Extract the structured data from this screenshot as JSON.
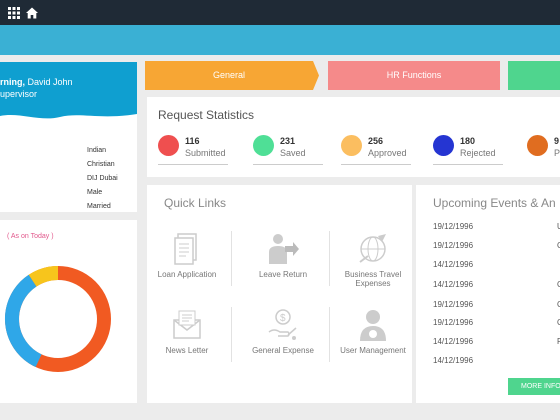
{
  "profile": {
    "greeting_bold": "rning,",
    "greeting_name": " David John",
    "role": "upervisor",
    "details": [
      "Indian",
      "Christian",
      "DIJ Dubai",
      "Male",
      "Married"
    ]
  },
  "chart": {
    "as_of": "( As on Today )"
  },
  "tabs": [
    {
      "label": "General",
      "color": "#f7a634"
    },
    {
      "label": "HR Functions",
      "color": "#f58a8a"
    },
    {
      "label": "",
      "color": "#4fd58e"
    }
  ],
  "stats": {
    "title": "Request Statistics",
    "items": [
      {
        "count": "116",
        "label": "Submitted",
        "color": "#ef4f4f"
      },
      {
        "count": "231",
        "label": "Saved",
        "color": "#4fdf96"
      },
      {
        "count": "256",
        "label": "Approved",
        "color": "#fbbe60"
      },
      {
        "count": "180",
        "label": "Rejected",
        "color": "#2535d2"
      },
      {
        "count": "9",
        "label": "P",
        "color": "#e06d20"
      }
    ]
  },
  "quick_links": {
    "title": "Quick Links",
    "items": [
      {
        "label": "Loan Application",
        "icon": "document-icon"
      },
      {
        "label": "Leave Return",
        "icon": "leave-return-icon"
      },
      {
        "label": "Business Travel Expenses",
        "icon": "globe-travel-icon"
      },
      {
        "label": "News Letter",
        "icon": "newsletter-icon"
      },
      {
        "label": "General Expense",
        "icon": "expense-icon"
      },
      {
        "label": "User Management",
        "icon": "user-icon"
      }
    ]
  },
  "events": {
    "title": "Upcoming Events & An",
    "dates": [
      "19/12/1996",
      "19/12/1996",
      "14/12/1996",
      "14/12/1996",
      "19/12/1996",
      "19/12/1996",
      "14/12/1996",
      "14/12/1996"
    ],
    "marks": [
      "U",
      "C",
      "",
      "C",
      "C",
      "C",
      "P",
      ""
    ],
    "more_label": "MORE INFO"
  }
}
